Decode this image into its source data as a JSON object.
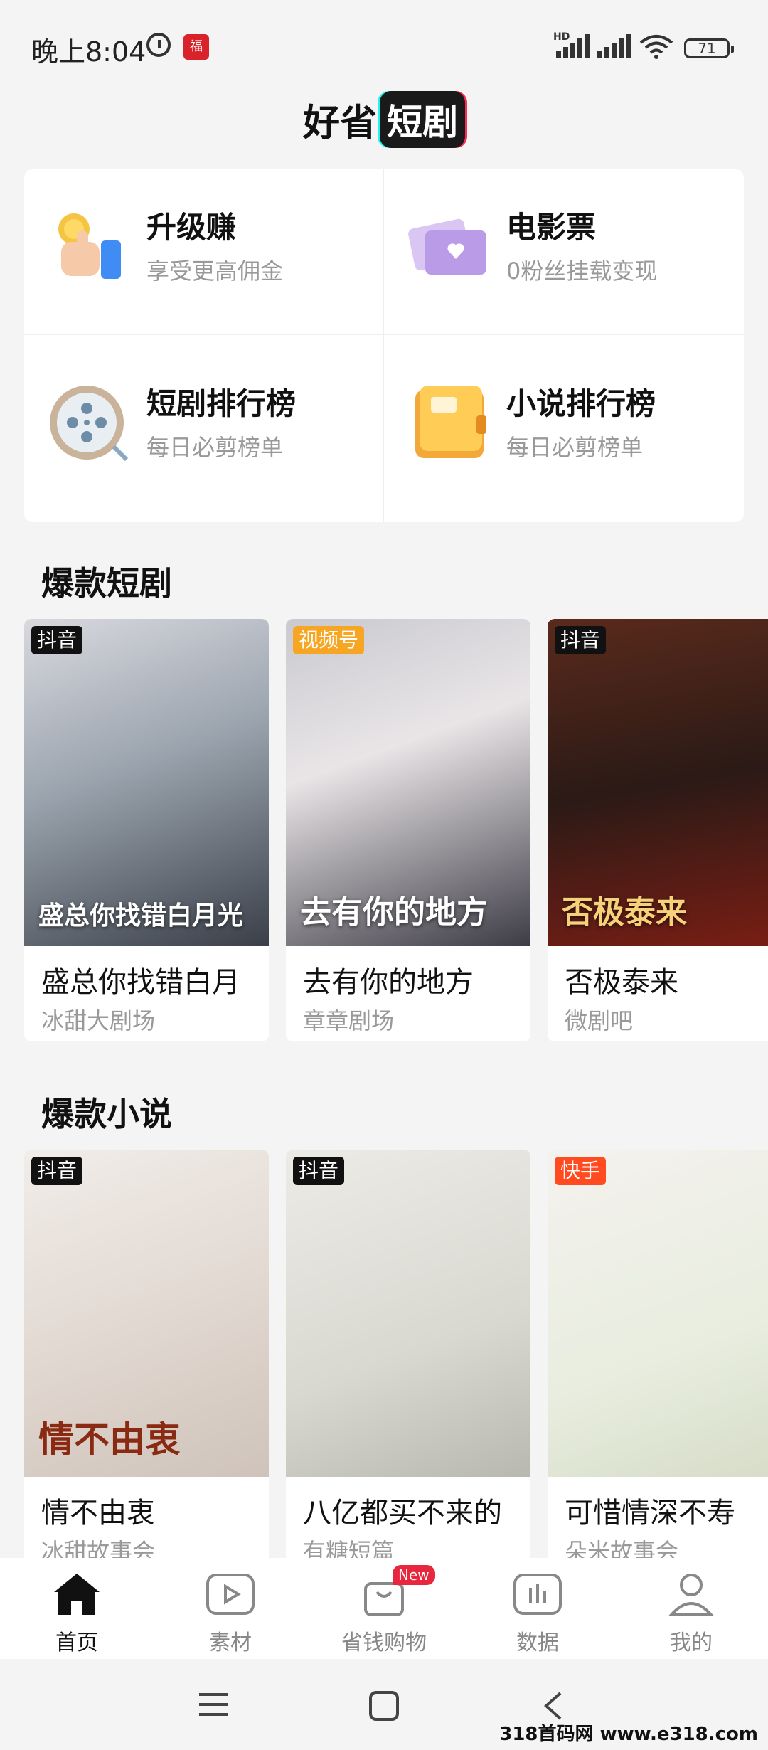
{
  "status": {
    "time": "晚上8:04",
    "notif": "福",
    "hd": "HD",
    "battery": "71"
  },
  "header": {
    "brand_a": "好省",
    "brand_b": "短剧"
  },
  "grid": [
    {
      "title": "升级赚",
      "sub": "享受更高佣金",
      "icon": "thumbs-up-coin-icon"
    },
    {
      "title": "电影票",
      "sub": "0粉丝挂载变现",
      "icon": "movie-ticket-icon"
    },
    {
      "title": "短剧排行榜",
      "sub": "每日必剪榜单",
      "icon": "film-reel-icon"
    },
    {
      "title": "小说排行榜",
      "sub": "每日必剪榜单",
      "icon": "notebook-icon"
    }
  ],
  "drama": {
    "title": "爆款短剧",
    "items": [
      {
        "tag": "抖音",
        "name": "盛总你找错白月",
        "src": "冰甜大剧场",
        "poster_text": "盛总你找错白月光"
      },
      {
        "tag": "视频号",
        "name": "去有你的地方",
        "src": "章章剧场",
        "poster_text": "去有你的地方"
      },
      {
        "tag": "抖音",
        "name": "否极泰来",
        "src": "微剧吧",
        "poster_text": "否极泰来"
      }
    ]
  },
  "novel": {
    "title": "爆款小说",
    "items": [
      {
        "tag": "抖音",
        "name": "情不由衷",
        "src": "冰甜故事会",
        "poster_text": "情不由衷"
      },
      {
        "tag": "抖音",
        "name": "八亿都买不来的",
        "src": "有糖短篇",
        "poster_text": ""
      },
      {
        "tag": "快手",
        "name": "可惜情深不寿",
        "src": "朵米故事会",
        "poster_text": ""
      }
    ]
  },
  "tabs": [
    {
      "label": "首页",
      "icon": "home-icon"
    },
    {
      "label": "素材",
      "icon": "play-icon"
    },
    {
      "label": "省钱购物",
      "icon": "shopping-bag-icon",
      "badge": "New"
    },
    {
      "label": "数据",
      "icon": "chart-icon"
    },
    {
      "label": "我的",
      "icon": "user-icon"
    }
  ],
  "watermark": "318首码网 www.e318.com"
}
